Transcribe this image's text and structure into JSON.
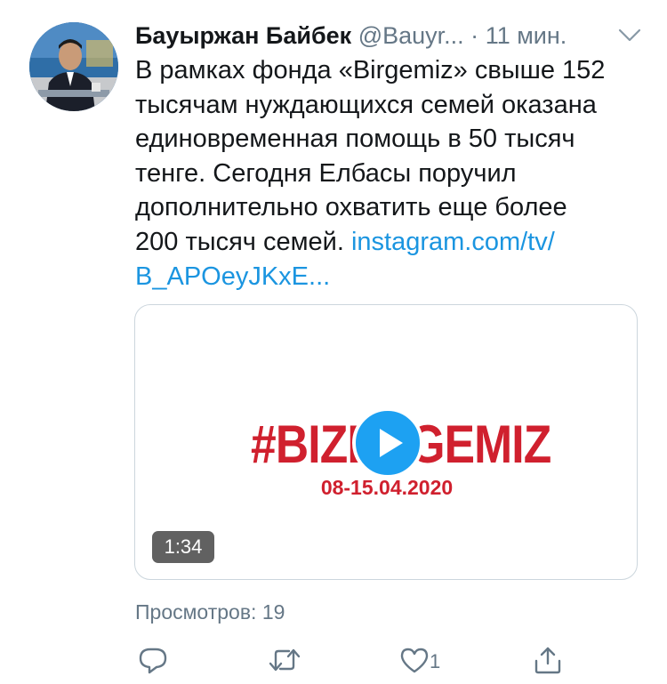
{
  "tweet": {
    "author_name": "Бауыржан Байбек",
    "handle": "@Bauyr...",
    "separator": "·",
    "time": "11 мин.",
    "text": "В рамках фонда «Birgemiz» свыше 152\nтысячам нуждающихся семей оказана\nединовременная помощь в 50 тысяч\nтенге. Сегодня Елбасы поручил\nдополнительно охватить еще более\n200 тысяч семей. ",
    "link": "instagram.com/tv/\nB_APOeyJKxE..."
  },
  "media": {
    "hashtag": "#BIZDEGEMIZ",
    "date": "08-15.04.2020",
    "duration": "1:34"
  },
  "stats": {
    "views": "Просмотров: 19",
    "like_count": "1"
  },
  "icons": {
    "caret": "chevron-down-icon",
    "reply": "reply-icon",
    "retweet": "retweet-icon",
    "like": "heart-icon",
    "share": "share-icon",
    "play": "play-icon"
  },
  "colors": {
    "link": "#1b95e0",
    "secondary_text": "#657786",
    "play_button": "#1da1f2",
    "hashtag_red": "#d0202e"
  }
}
